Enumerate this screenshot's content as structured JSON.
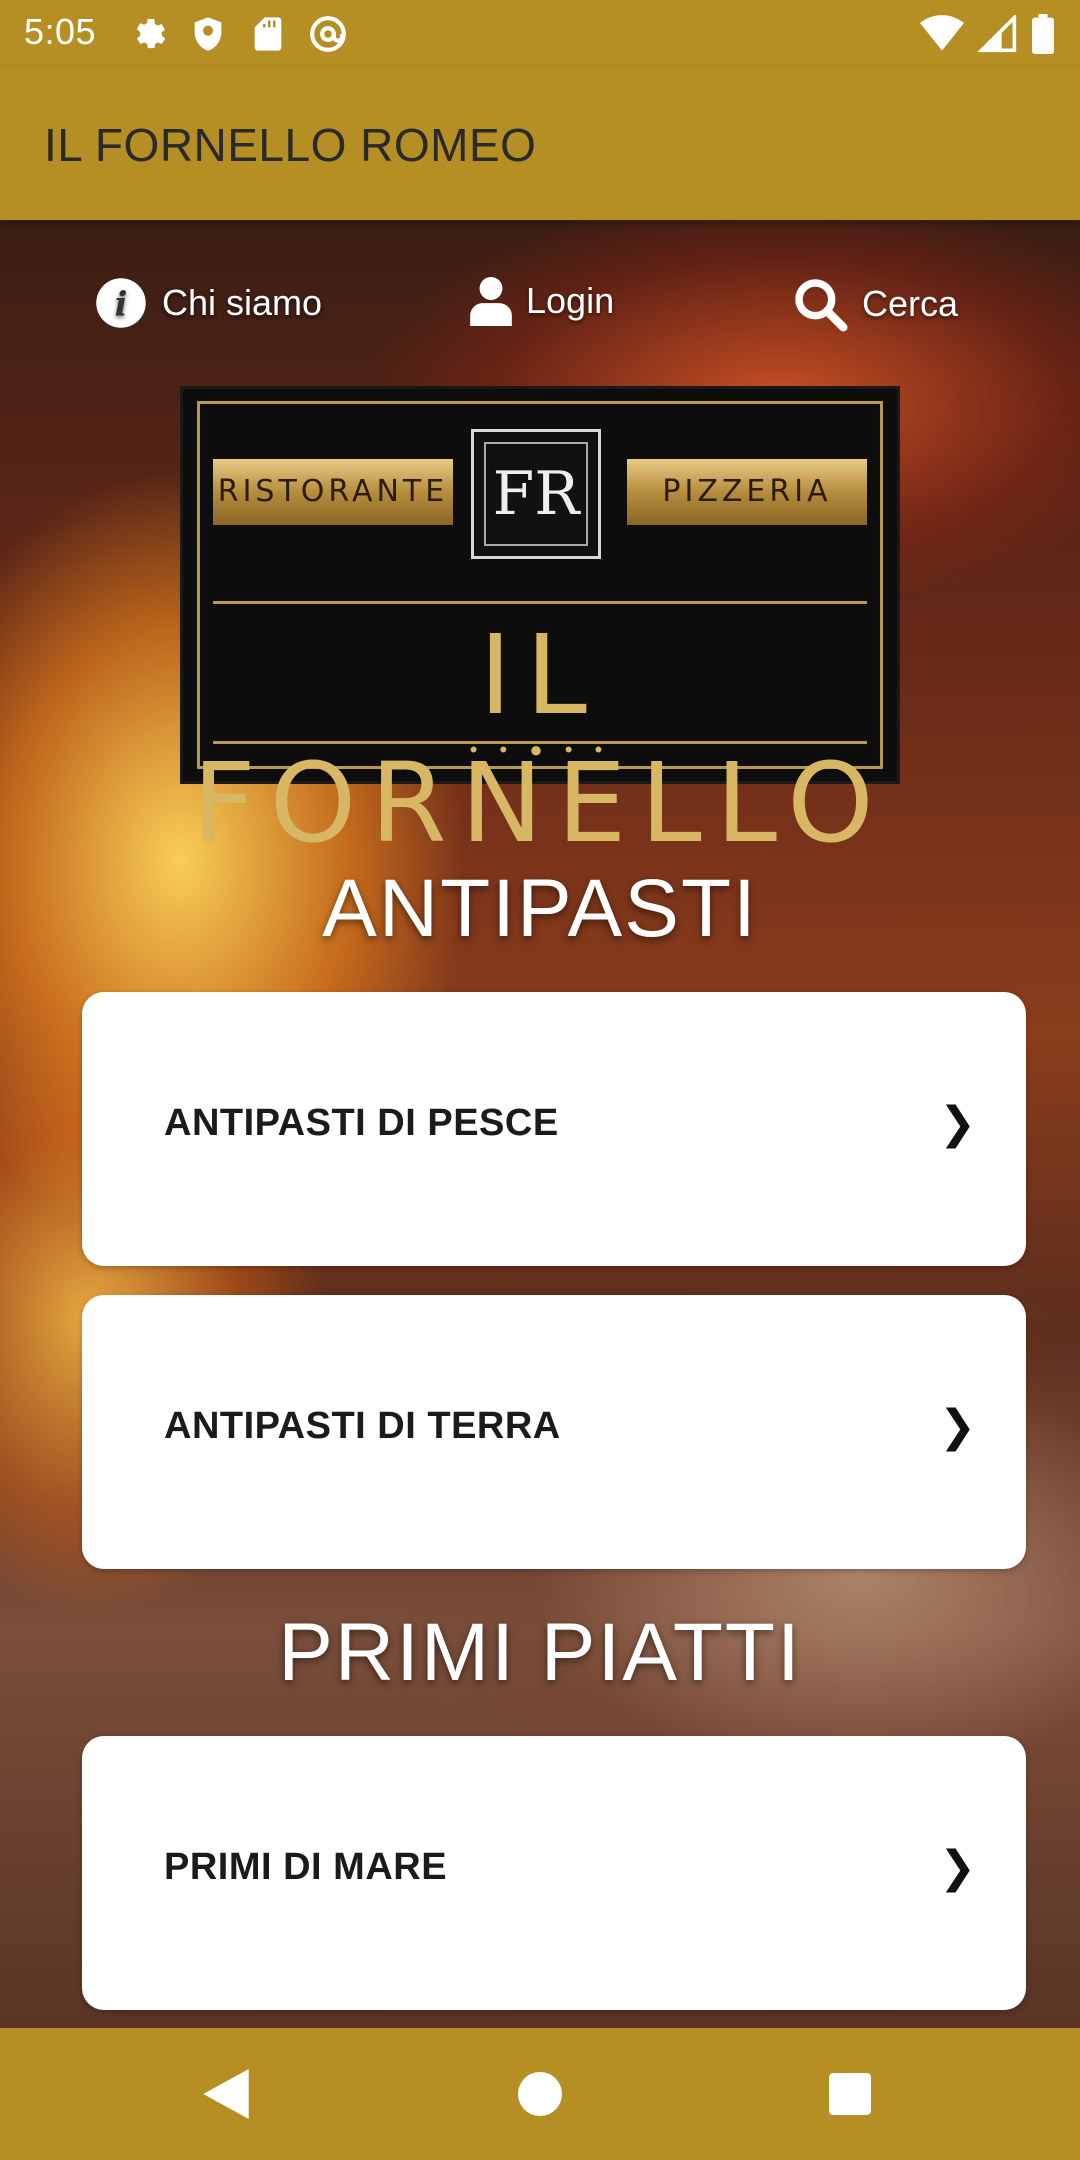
{
  "status_bar": {
    "time": "5:05",
    "left_icons": [
      "settings-icon",
      "shield-icon",
      "sd-card-icon",
      "at-sign-icon"
    ],
    "right_icons": [
      "wifi-icon",
      "signal-icon",
      "battery-icon"
    ]
  },
  "app_bar": {
    "title": "IL FORNELLO ROMEO"
  },
  "top_nav": {
    "about_label": "Chi siamo",
    "login_label": "Login",
    "search_label": "Cerca"
  },
  "logo": {
    "left_band": "RISTORANTE",
    "right_band": "PIZZERIA",
    "monogram": "FR",
    "main_text": "IL FORNELLO"
  },
  "sections": [
    {
      "title": "ANTIPASTI",
      "items": [
        {
          "label": "ANTIPASTI DI PESCE"
        },
        {
          "label": "ANTIPASTI DI TERRA"
        }
      ]
    },
    {
      "title": "PRIMI PIATTI",
      "items": [
        {
          "label": "PRIMI DI MARE"
        }
      ]
    }
  ],
  "chevron": "❯",
  "colors": {
    "accent": "#b58f24",
    "card": "#ffffff",
    "logo_gold": "#d8b764"
  }
}
